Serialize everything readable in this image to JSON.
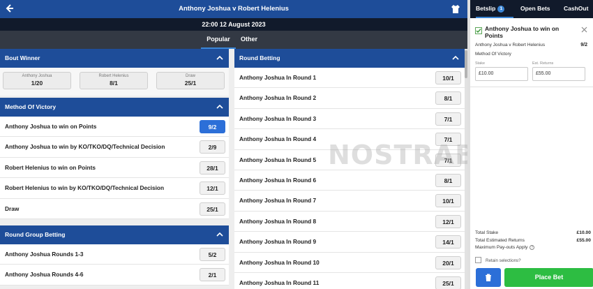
{
  "header": {
    "title": "Anthony Joshua v Robert Helenius",
    "datetime": "22:00 12 August 2023",
    "tabs": [
      {
        "label": "Popular",
        "active": true
      },
      {
        "label": "Other",
        "active": false
      }
    ]
  },
  "bout_winner": {
    "title": "Bout Winner",
    "selections": [
      {
        "name": "Anthony Joshua",
        "odds": "1/20"
      },
      {
        "name": "Robert Helenius",
        "odds": "8/1"
      },
      {
        "name": "Draw",
        "odds": "25/1"
      }
    ]
  },
  "method_of_victory": {
    "title": "Method Of Victory",
    "rows": [
      {
        "label": "Anthony Joshua to win on Points",
        "odds": "9/2",
        "selected": true
      },
      {
        "label": "Anthony Joshua to win by KO/TKO/DQ/Technical Decision",
        "odds": "2/9",
        "selected": false
      },
      {
        "label": "Robert Helenius to win on Points",
        "odds": "28/1",
        "selected": false
      },
      {
        "label": "Robert Helenius to win by KO/TKO/DQ/Technical Decision",
        "odds": "12/1",
        "selected": false
      },
      {
        "label": "Draw",
        "odds": "25/1",
        "selected": false
      }
    ]
  },
  "round_group_betting": {
    "title": "Round Group Betting",
    "rows": [
      {
        "label": "Anthony Joshua Rounds 1-3",
        "odds": "5/2"
      },
      {
        "label": "Anthony Joshua Rounds 4-6",
        "odds": "2/1"
      }
    ]
  },
  "round_betting": {
    "title": "Round Betting",
    "rows": [
      {
        "label": "Anthony Joshua In Round 1",
        "odds": "10/1"
      },
      {
        "label": "Anthony Joshua In Round 2",
        "odds": "8/1"
      },
      {
        "label": "Anthony Joshua In Round 3",
        "odds": "7/1"
      },
      {
        "label": "Anthony Joshua In Round 4",
        "odds": "7/1"
      },
      {
        "label": "Anthony Joshua In Round 5",
        "odds": "7/1"
      },
      {
        "label": "Anthony Joshua In Round 6",
        "odds": "8/1"
      },
      {
        "label": "Anthony Joshua In Round 7",
        "odds": "10/1"
      },
      {
        "label": "Anthony Joshua In Round 8",
        "odds": "12/1"
      },
      {
        "label": "Anthony Joshua In Round 9",
        "odds": "14/1"
      },
      {
        "label": "Anthony Joshua In Round 10",
        "odds": "20/1"
      },
      {
        "label": "Anthony Joshua In Round 11",
        "odds": "25/1"
      }
    ]
  },
  "watermark": "NOSTRABET",
  "betslip": {
    "tabs": [
      {
        "label": "Betslip",
        "count": "1",
        "active": true
      },
      {
        "label": "Open Bets",
        "active": false
      },
      {
        "label": "CashOut",
        "active": false
      }
    ],
    "bet": {
      "selection": "Anthony Joshua to win on Points",
      "event": "Anthony Joshua v Robert Helenius",
      "odds": "9/2",
      "market": "Method Of Victory",
      "stake_label": "Stake",
      "stake_value": "£10.00",
      "returns_label": "Est. Returns",
      "returns_value": "£55.00"
    },
    "totals": {
      "total_stake_label": "Total Stake",
      "total_stake": "£10.00",
      "total_returns_label": "Total Estimated Returns",
      "total_returns": "£55.00",
      "max_payout_label": "Maximum Pay-outs Apply"
    },
    "retain_label": "Retain selections?",
    "place_bet_label": "Place Bet"
  },
  "colors": {
    "header_blue": "#1e4d99",
    "dark_bar": "#111a2b",
    "selected_odds": "#2c6fd8",
    "place_bet_green": "#2dbd42"
  }
}
